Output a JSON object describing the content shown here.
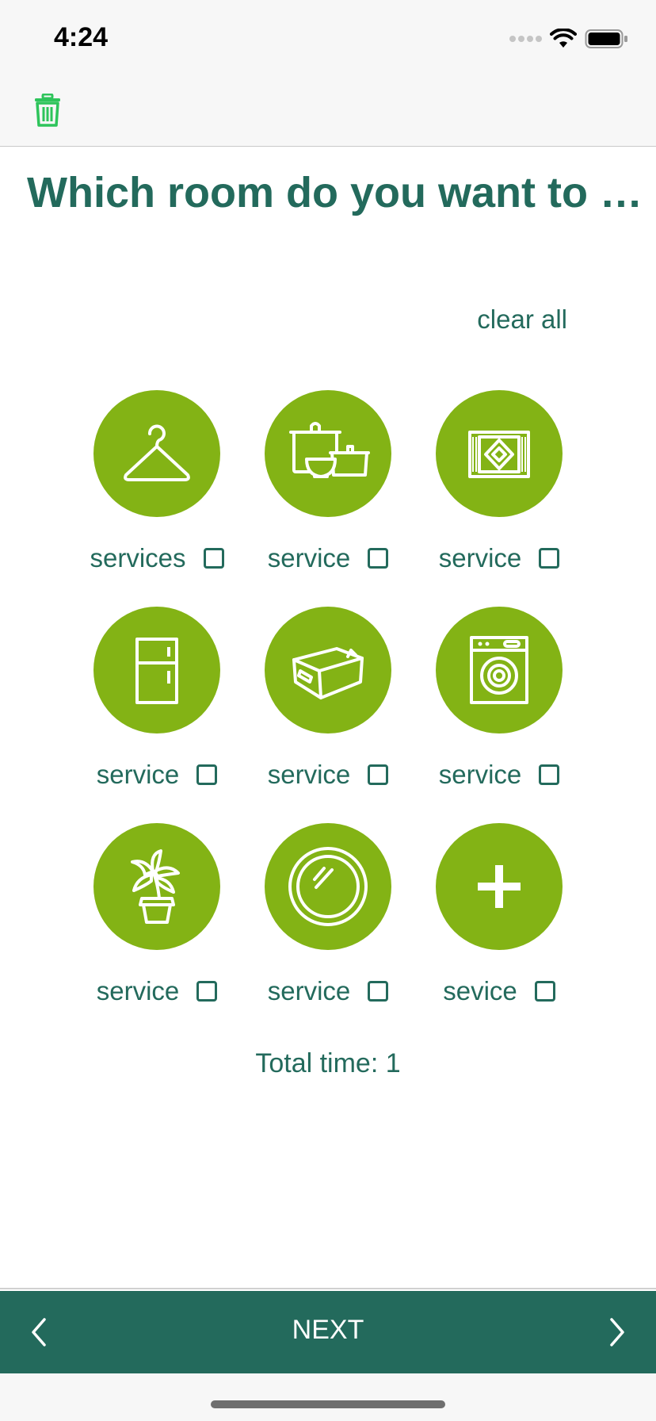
{
  "status_bar": {
    "time": "4:24",
    "icons": [
      "signal-icon",
      "wifi-icon",
      "battery-icon"
    ]
  },
  "nav": {
    "left_icon": "trash-icon"
  },
  "title": "Which room do you want to b…",
  "clear_all_label": "clear all",
  "services": [
    {
      "label": "services",
      "icon": "hanger-icon",
      "checked": false
    },
    {
      "label": "service",
      "icon": "cookware-icon",
      "checked": false
    },
    {
      "label": "service",
      "icon": "rug-icon",
      "checked": false
    },
    {
      "label": "service",
      "icon": "fridge-icon",
      "checked": false
    },
    {
      "label": "service",
      "icon": "box-icon",
      "checked": false
    },
    {
      "label": "service",
      "icon": "washing-machine-icon",
      "checked": false
    },
    {
      "label": "service",
      "icon": "plant-icon",
      "checked": false
    },
    {
      "label": "service",
      "icon": "mirror-icon",
      "checked": false
    },
    {
      "label": "sevice",
      "icon": "plus-icon",
      "checked": false
    }
  ],
  "total_time_label": "Total time: 1",
  "bottom_bar": {
    "next_label": "NEXT",
    "prev_icon": "chevron-left-icon",
    "next_icon": "chevron-right-icon"
  },
  "colors": {
    "accent_green": "#83b315",
    "primary_teal": "#236a5c",
    "trash_green": "#2ec45b"
  }
}
